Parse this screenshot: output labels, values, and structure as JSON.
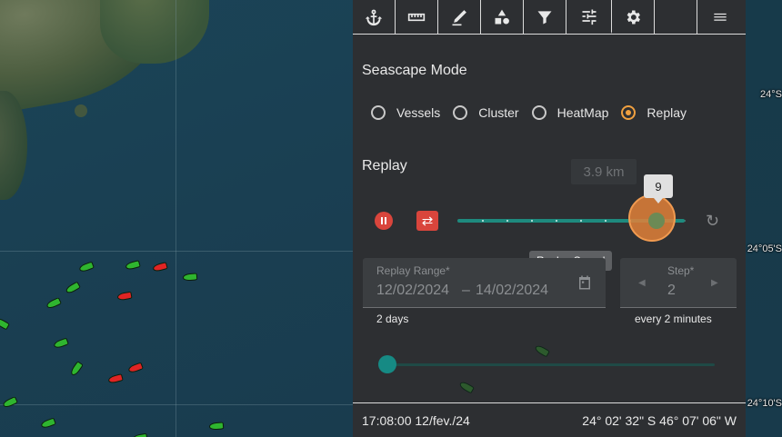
{
  "map": {
    "coord_labels": [
      "24°S",
      "24°05'S",
      "24°10'S"
    ]
  },
  "toolbar": {
    "buttons": [
      {
        "icon": "anchor-icon",
        "glyph": "⚓"
      },
      {
        "icon": "ruler-icon",
        "glyph": "📏"
      },
      {
        "icon": "draw-icon",
        "glyph": "✎"
      },
      {
        "icon": "shapes-icon",
        "glyph": "◆"
      },
      {
        "icon": "filter-icon",
        "glyph": "▼"
      },
      {
        "icon": "sliders-icon",
        "glyph": "☰"
      },
      {
        "icon": "gear-icon",
        "glyph": "⚙"
      },
      {
        "icon": "blank-icon",
        "glyph": ""
      },
      {
        "icon": "menu-icon",
        "glyph": "☰"
      }
    ],
    "active_index": 5
  },
  "seascape": {
    "title": "Seascape Mode",
    "options": [
      {
        "label": "Vessels",
        "checked": false
      },
      {
        "label": "Cluster",
        "checked": false
      },
      {
        "label": "HeatMap",
        "checked": false
      },
      {
        "label": "Replay",
        "checked": true
      }
    ]
  },
  "replay": {
    "title": "Replay",
    "distance_chip": "3.9 km",
    "speed_value": "9",
    "speed_fraction": 0.88,
    "speed_tooltip": "Replay Speed",
    "range": {
      "label": "Replay Range*",
      "start": "12/02/2024",
      "separator": "–",
      "end": "14/02/2024",
      "hint": "2 days"
    },
    "step": {
      "label": "Step*",
      "value": "2",
      "hint": "every 2 minutes"
    },
    "progress_fraction": 0.0
  },
  "footer": {
    "time": "17:08:00 12/fev./24",
    "coords": "24° 02' 32\" S 46° 07' 06\" W"
  },
  "colors": {
    "accent": "#f0a040",
    "teal": "#1e8a7e",
    "danger": "#d9453c",
    "panel": "#2d2f32"
  }
}
